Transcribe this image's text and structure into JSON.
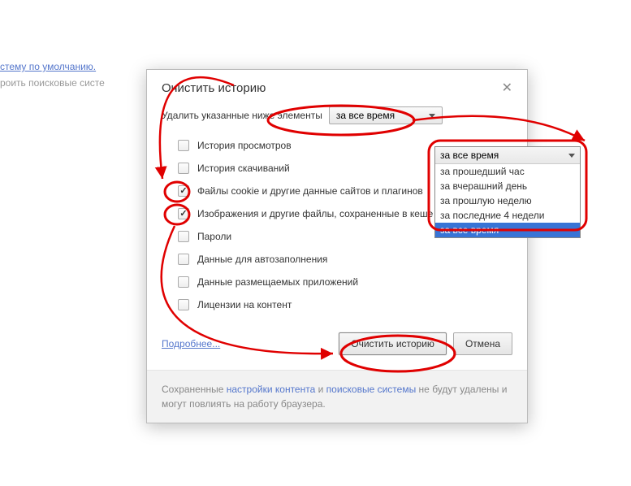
{
  "background": {
    "link1": "стему по умолчанию.",
    "link2": "роить поисковые систе"
  },
  "dialog": {
    "title": "Очистить историю",
    "delete_label": "Удалить указанные ниже элементы",
    "time_selected": "за все время",
    "checks": [
      {
        "label": "История просмотров",
        "checked": false
      },
      {
        "label": "История скачиваний",
        "checked": false
      },
      {
        "label": "Файлы cookie и другие данные сайтов и плагинов",
        "checked": true
      },
      {
        "label": "Изображения и другие файлы, сохраненные в кеше",
        "checked": true
      },
      {
        "label": "Пароли",
        "checked": false
      },
      {
        "label": "Данные для автозаполнения",
        "checked": false
      },
      {
        "label": "Данные размещаемых приложений",
        "checked": false
      },
      {
        "label": "Лицензии на контент",
        "checked": false
      }
    ],
    "more": "Подробнее...",
    "clear_btn": "Очистить историю",
    "cancel_btn": "Отмена",
    "footer_pre": "Сохраненные ",
    "footer_l1": "настройки контента",
    "footer_mid": " и ",
    "footer_l2": "поисковые системы",
    "footer_post": " не будут удалены и могут повлиять на работу браузера."
  },
  "dropdown": {
    "top": "за все время",
    "options": [
      {
        "label": "за прошедший час",
        "selected": false
      },
      {
        "label": "за вчерашний день",
        "selected": false
      },
      {
        "label": "за прошлую неделю",
        "selected": false
      },
      {
        "label": "за последние 4 недели",
        "selected": false
      },
      {
        "label": "за все время",
        "selected": true
      }
    ]
  }
}
